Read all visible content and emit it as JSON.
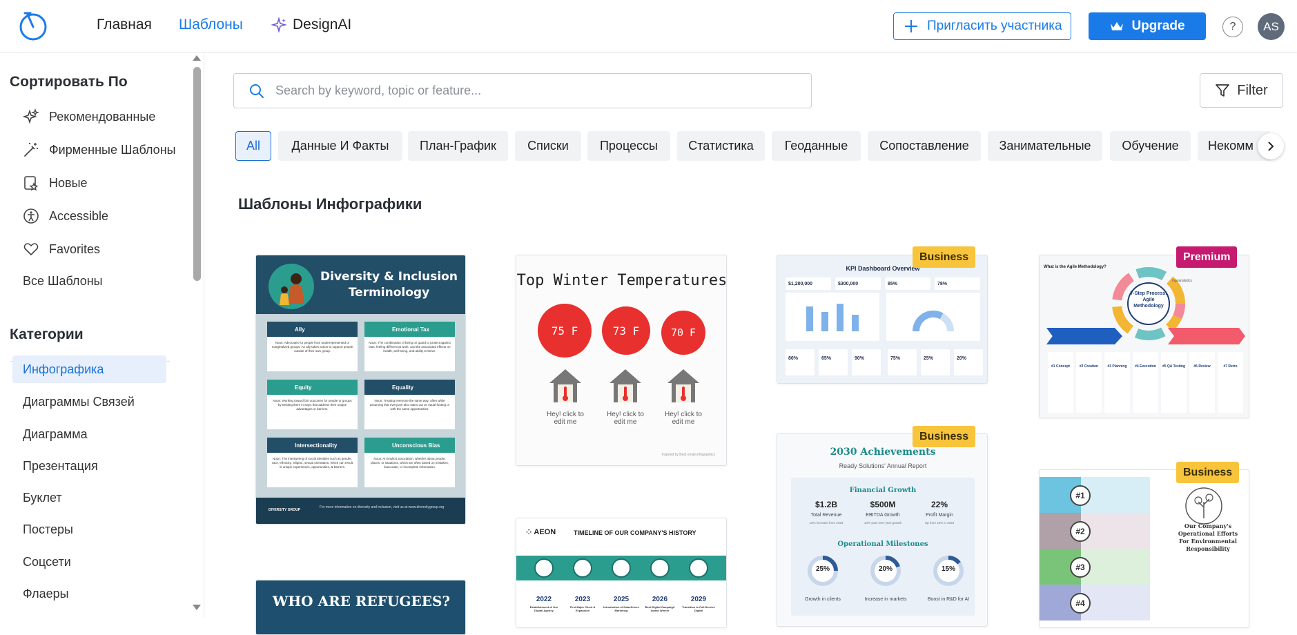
{
  "nav": {
    "home": "Главная",
    "templates": "Шаблоны",
    "designai": "DesignAI",
    "invite": "Пригласить участника",
    "upgrade": "Upgrade",
    "help": "?",
    "avatar_initials": "AS"
  },
  "sidebar": {
    "sort_heading": "Сортировать По",
    "sort_items": [
      "Рекомендованные",
      "Фирменные Шаблоны",
      "Новые",
      "Accessible",
      "Favorites",
      "Все Шаблоны"
    ],
    "categories_heading": "Категории",
    "categories": [
      "Инфографика",
      "Диаграммы Связей",
      "Диаграмма",
      "Презентация",
      "Буклет",
      "Постеры",
      "Соцсети",
      "Флаеры"
    ]
  },
  "search": {
    "placeholder": "Search by keyword, topic or feature..."
  },
  "filter": {
    "label": "Filter"
  },
  "chips": [
    "All",
    "Данные И Факты",
    "План-График",
    "Списки",
    "Процессы",
    "Статистика",
    "Геоданные",
    "Сопоставление",
    "Занимательные",
    "Обучение",
    "Некомм"
  ],
  "section_title": "Шаблоны Инфографики",
  "badges": {
    "business": "Business",
    "premium": "Premium"
  },
  "cards": {
    "diversity": {
      "title": "Diversity & Inclusion Terminology",
      "terms": [
        {
          "name": "Ally",
          "text": "Noun: Advocates for people from underrepresented or marginalized groups. An ally takes action to support people outside of their own group."
        },
        {
          "name": "Emotional Tax",
          "text": "Noun: The combination of being on guard to protect against bias, feeling different at work, and the associated effects on health, well-being, and ability to thrive."
        },
        {
          "name": "Equity",
          "text": "Noun: Working toward fair outcomes for people or groups by treating them in ways that address their unique advantages or barriers."
        },
        {
          "name": "Equality",
          "text": "Noun: Treating everyone the same way, often while assuming that everyone also starts out on equal footing or with the same opportunities."
        },
        {
          "name": "Intersectionality",
          "text": "Noun: The intertwining of social identities such as gender, race, ethnicity, religion, sexual orientation, which can result in unique experiences, opportunities, & barriers."
        },
        {
          "name": "Unconscious Bias",
          "text": "Noun: An implicit association, whether about people, places, or situations, which are often based on mistaken, inaccurate, or incomplete information."
        }
      ],
      "footer": "For more information on diversity and inclusion, visit us at www.diversitygroup.org",
      "brand": "DIVERSITY GROUP"
    },
    "winter": {
      "title": "Top Winter Temperatures",
      "temps": [
        "75 F",
        "73 F",
        "70 F"
      ],
      "cta": "Hey! click to edit me",
      "credit": "Inspired by Best email infographics"
    },
    "kpi": {
      "title": "KPI Dashboard Overview",
      "stats": [
        "$1,200,000",
        "$300,000",
        "85%",
        "78%"
      ],
      "mini": [
        "80%",
        "65%",
        "90%",
        "75%",
        "25%",
        "20%"
      ]
    },
    "agile": {
      "question": "What is the Agile Methodology?",
      "center": "7-Step Process: Agile Methodology",
      "brand": "ingoanalytics",
      "steps": [
        "#1 Concept",
        "#2 Creation",
        "#3 Planning",
        "#4 Execution",
        "#5 QA Testing",
        "#6 Review",
        "#7 Retro"
      ]
    },
    "achievements": {
      "title": "2030 Achievements",
      "subtitle": "Ready Solutions' Annual Report",
      "financial_heading": "Financial Growth",
      "metrics": [
        {
          "value": "$1.2B",
          "label": "Total Revenue",
          "sub": "15% increase from 2023"
        },
        {
          "value": "$500M",
          "label": "EBITDA Growth",
          "sub": "10% year-over-year growth"
        },
        {
          "value": "22%",
          "label": "Profit Margin",
          "sub": "Up from 18% in 2023"
        }
      ],
      "milestones_heading": "Operational Milestones",
      "milestones": [
        {
          "value": "25%",
          "label": "Growth in clients",
          "fraction": 0.25
        },
        {
          "value": "20%",
          "label": "Increase in markets",
          "fraction": 0.2
        },
        {
          "value": "15%",
          "label": "Boost in R&D for AI",
          "fraction": 0.15
        }
      ]
    },
    "refugees": {
      "title": "WHO ARE REFUGEES?"
    },
    "timeline": {
      "brand": "AEON",
      "title": "TIMELINE OF OUR COMPANY'S HISTORY",
      "years": [
        "2022",
        "2023",
        "2025",
        "2026",
        "2029"
      ],
      "events": [
        "Establishment of Our Digital Agency",
        "First Major Client & Expansion",
        "Introduction of Data-Driven Marketing",
        "'Best Digital Campaign' Award Winner",
        "Transition to Full-Service Digital"
      ]
    },
    "environment": {
      "nums": [
        "#1",
        "#2",
        "#3",
        "#4"
      ],
      "title": "Our Company's Operational Efforts For Environmental Responsibility"
    }
  },
  "colors": {
    "accent": "#1a7be8",
    "business_badge": "#f7c43c",
    "premium_badge": "#c51a6f",
    "diversity_bg": "#234e68",
    "winter_red": "#e8302e",
    "timeline_teal": "#2a9d8f"
  }
}
